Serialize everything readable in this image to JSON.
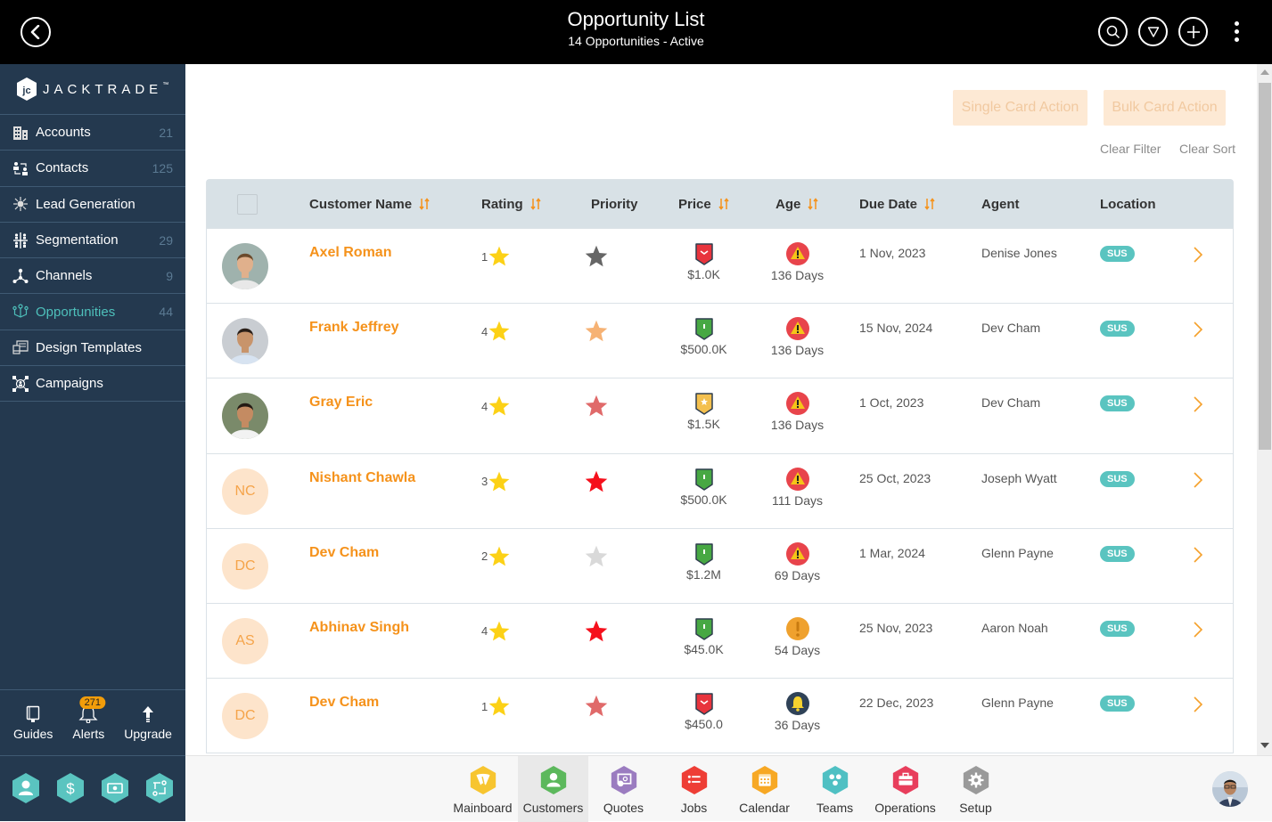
{
  "header": {
    "title": "Opportunity List",
    "subtitle": "14 Opportunities - Active",
    "icons": [
      "back-icon",
      "search-icon",
      "filter-icon",
      "add-icon",
      "more-vertical-icon"
    ]
  },
  "brand": {
    "name": "JACKTRADE",
    "tm": "™"
  },
  "sidebar": {
    "items": [
      {
        "label": "Accounts",
        "count": "21",
        "icon": "building-icon"
      },
      {
        "label": "Contacts",
        "count": "125",
        "icon": "contacts-icon"
      },
      {
        "label": "Lead Generation",
        "count": "",
        "icon": "lead-generation-icon"
      },
      {
        "label": "Segmentation",
        "count": "29",
        "icon": "segmentation-icon"
      },
      {
        "label": "Channels",
        "count": "9",
        "icon": "channels-icon"
      },
      {
        "label": "Opportunities",
        "count": "44",
        "icon": "opportunities-icon",
        "active": true
      },
      {
        "label": "Design Templates",
        "count": "",
        "icon": "design-templates-icon"
      },
      {
        "label": "Campaigns",
        "count": "",
        "icon": "campaigns-icon"
      }
    ],
    "utilities": [
      {
        "label": "Guides",
        "icon": "book-icon"
      },
      {
        "label": "Alerts",
        "icon": "bell-icon",
        "badge": "271"
      },
      {
        "label": "Upgrade",
        "icon": "arrow-up-icon"
      }
    ],
    "quick_icons": [
      "person-hex-icon",
      "dollar-hex-icon",
      "money-hex-icon",
      "workflow-hex-icon"
    ]
  },
  "actions": {
    "single_card": "Single Card Action",
    "bulk_card": "Bulk Card Action",
    "clear_filter": "Clear Filter",
    "clear_sort": "Clear Sort"
  },
  "table": {
    "columns": {
      "customer_name": "Customer Name",
      "rating": "Rating",
      "priority": "Priority",
      "price": "Price",
      "age": "Age",
      "due_date": "Due Date",
      "agent": "Agent",
      "location": "Location"
    },
    "rows": [
      {
        "name": "Axel Roman",
        "initials": "",
        "photo": "photo-1",
        "rating": "1",
        "priority_color": "#666666",
        "price": "$1.0K",
        "price_badge": "red",
        "age": "136 Days",
        "age_status": "warning-red",
        "due": "1 Nov, 2023",
        "agent": "Denise Jones",
        "location": "SUS"
      },
      {
        "name": "Frank Jeffrey",
        "initials": "",
        "photo": "photo-2",
        "rating": "4",
        "priority_color": "#f6b274",
        "price": "$500.0K",
        "price_badge": "green",
        "age": "136 Days",
        "age_status": "warning-red",
        "due": "15 Nov, 2024",
        "agent": "Dev Cham",
        "location": "SUS"
      },
      {
        "name": "Gray Eric",
        "initials": "",
        "photo": "photo-3",
        "rating": "4",
        "priority_color": "#e06a6a",
        "price": "$1.5K",
        "price_badge": "yellow",
        "age": "136 Days",
        "age_status": "warning-red",
        "due": "1 Oct, 2023",
        "agent": "Dev Cham",
        "location": "SUS"
      },
      {
        "name": "Nishant Chawla",
        "initials": "NC",
        "photo": "",
        "rating": "3",
        "priority_color": "#f5101c",
        "price": "$500.0K",
        "price_badge": "green",
        "age": "111 Days",
        "age_status": "warning-red",
        "due": "25 Oct, 2023",
        "agent": "Joseph Wyatt",
        "location": "SUS"
      },
      {
        "name": "Dev Cham",
        "initials": "DC",
        "photo": "",
        "rating": "2",
        "priority_color": "#d9d9d9",
        "price": "$1.2M",
        "price_badge": "green",
        "age": "69 Days",
        "age_status": "warning-red",
        "due": "1 Mar, 2024",
        "agent": "Glenn Payne",
        "location": "SUS"
      },
      {
        "name": "Abhinav Singh",
        "initials": "AS",
        "photo": "",
        "rating": "4",
        "priority_color": "#f5101c",
        "price": "$45.0K",
        "price_badge": "green",
        "age": "54 Days",
        "age_status": "exclaim-orange",
        "due": "25 Nov, 2023",
        "agent": "Aaron Noah",
        "location": "SUS"
      },
      {
        "name": "Dev Cham",
        "initials": "DC",
        "photo": "",
        "rating": "1",
        "priority_color": "#e06a6a",
        "price": "$450.0",
        "price_badge": "red",
        "age": "36 Days",
        "age_status": "bell-dark",
        "due": "22 Dec, 2023",
        "agent": "Glenn Payne",
        "location": "SUS"
      }
    ]
  },
  "bottom_nav": {
    "tabs": [
      {
        "label": "Mainboard",
        "color": "#f7c530",
        "icon": "mainboard-icon"
      },
      {
        "label": "Customers",
        "color": "#5cb85c",
        "icon": "customers-icon",
        "active": true
      },
      {
        "label": "Quotes",
        "color": "#9b7cc0",
        "icon": "quotes-icon"
      },
      {
        "label": "Jobs",
        "color": "#ee3e36",
        "icon": "jobs-icon"
      },
      {
        "label": "Calendar",
        "color": "#f7a824",
        "icon": "calendar-icon"
      },
      {
        "label": "Teams",
        "color": "#4fc0c3",
        "icon": "teams-icon"
      },
      {
        "label": "Operations",
        "color": "#e83e5c",
        "icon": "operations-icon"
      },
      {
        "label": "Setup",
        "color": "#9a9a9a",
        "icon": "setup-icon"
      }
    ]
  },
  "colors": {
    "accent": "#f5921b",
    "sidebar_bg": "#24394f",
    "active_nav": "#4ec0bb",
    "location_badge": "#5ac4c0",
    "star_rating": "#fcd116"
  }
}
